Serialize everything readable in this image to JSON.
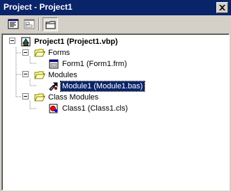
{
  "window": {
    "title": "Project - Project1"
  },
  "toolbar": {
    "view_code": "view-code-icon",
    "view_object": "view-object-icon",
    "toggle_folders": "folder-icon"
  },
  "tree": {
    "root": {
      "label": "Project1 (Project1.vbp)"
    },
    "forms": {
      "label": "Forms",
      "items": [
        {
          "label": "Form1 (Form1.frm)"
        }
      ]
    },
    "modules": {
      "label": "Modules",
      "items": [
        {
          "label": "Module1 (Module1.bas)",
          "selected": true
        }
      ]
    },
    "class_modules": {
      "label": "Class Modules",
      "items": [
        {
          "label": "Class1 (Class1.cls)"
        }
      ]
    }
  },
  "colors": {
    "titlebar": "#0a246a",
    "selection": "#0a246a",
    "face": "#d4d0c8"
  }
}
